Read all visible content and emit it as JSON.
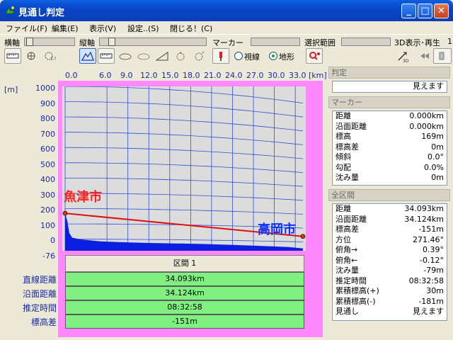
{
  "window": {
    "title": "見通し判定",
    "min": "_",
    "max": "□",
    "close": "✕"
  },
  "menu": [
    "ファイル(F)",
    "編集(E)",
    "表示(V)",
    "設定..(S)",
    "閉じる！(C)"
  ],
  "toolbar": {
    "horiz_label": "横軸",
    "vert_label": "縦軸",
    "marker_label": "マーカー",
    "select_label": "選択範囲",
    "play_label": "3D表示･再生",
    "play_extra": "1",
    "radio_line": "視線",
    "radio_terrain": "地形",
    "radio_selected": "地形"
  },
  "chart": {
    "x_unit_left": "[m]",
    "x_unit_right": "[km]",
    "x_ticks": [
      "0.0",
      "6.0",
      "9.0",
      "12.0",
      "15.0",
      "18.0",
      "21.0",
      "24.0",
      "27.0",
      "30.0",
      "33.0"
    ],
    "y_ticks": [
      "1000",
      "900",
      "800",
      "700",
      "600",
      "500",
      "400",
      "300",
      "200",
      "100",
      "0",
      "-76"
    ],
    "label_start": "魚津市",
    "label_end": "高岡市"
  },
  "chart_data": {
    "type": "area",
    "xlabel": "",
    "ylabel": "",
    "x_unit": "km",
    "y_unit": "m",
    "xlim": [
      0,
      34.1
    ],
    "ylim": [
      -76,
      1000
    ],
    "terrain": {
      "x": [
        0,
        0.3,
        0.6,
        1.0,
        1.5,
        2.0,
        3.0,
        5.0,
        8.0,
        12.0,
        16.0,
        20.0,
        24.0,
        28.0,
        32.0,
        34.09
      ],
      "y": [
        169,
        120,
        40,
        10,
        5,
        0,
        -5,
        -15,
        -20,
        -25,
        -28,
        -32,
        -38,
        -44,
        -52,
        -60
      ]
    },
    "sightline": {
      "x": [
        0,
        34.093
      ],
      "y": [
        169,
        18
      ]
    }
  },
  "section": {
    "header": "区間 1",
    "rows": [
      {
        "label": "直線距離",
        "value": "34.093km"
      },
      {
        "label": "沿面距離",
        "value": "34.124km"
      },
      {
        "label": "推定時間",
        "value": "08:32:58"
      },
      {
        "label": "標高差",
        "value": "-151m"
      }
    ]
  },
  "right": {
    "judge_header": "判定",
    "judge_value": "見えます",
    "marker_header": "マーカー",
    "marker_rows": [
      {
        "k": "距離",
        "v": "0.000km"
      },
      {
        "k": "沿面距離",
        "v": "0.000km"
      },
      {
        "k": "標高",
        "v": "169m"
      },
      {
        "k": "標高差",
        "v": "0m"
      },
      {
        "k": "傾斜",
        "v": "0.0°"
      },
      {
        "k": "勾配",
        "v": "0.0%"
      },
      {
        "k": "沈み量",
        "v": "0m"
      }
    ],
    "all_header": "全区間",
    "all_rows": [
      {
        "k": "距離",
        "v": "34.093km"
      },
      {
        "k": "沿面距離",
        "v": "34.124km"
      },
      {
        "k": "標高差",
        "v": "-151m"
      },
      {
        "k": "方位",
        "v": "271.46°"
      },
      {
        "k": "俯角→",
        "v": "0.39°"
      },
      {
        "k": "俯角←",
        "v": "-0.12°"
      },
      {
        "k": "沈み量",
        "v": "-79m"
      },
      {
        "k": "推定時間",
        "v": "08:32:58"
      },
      {
        "k": "累積標高(+)",
        "v": "30m"
      },
      {
        "k": "累積標高(-)",
        "v": "-181m"
      },
      {
        "k": "見通し",
        "v": "見えます"
      }
    ]
  },
  "colors": {
    "terrain": "#0a1fe0",
    "sightline": "#e01010",
    "label_start": "#ff2020",
    "label_end": "#1030ff",
    "plot_bg": "#dcdcdc",
    "frame": "#ff88ff",
    "panel_green": "#80f080"
  }
}
